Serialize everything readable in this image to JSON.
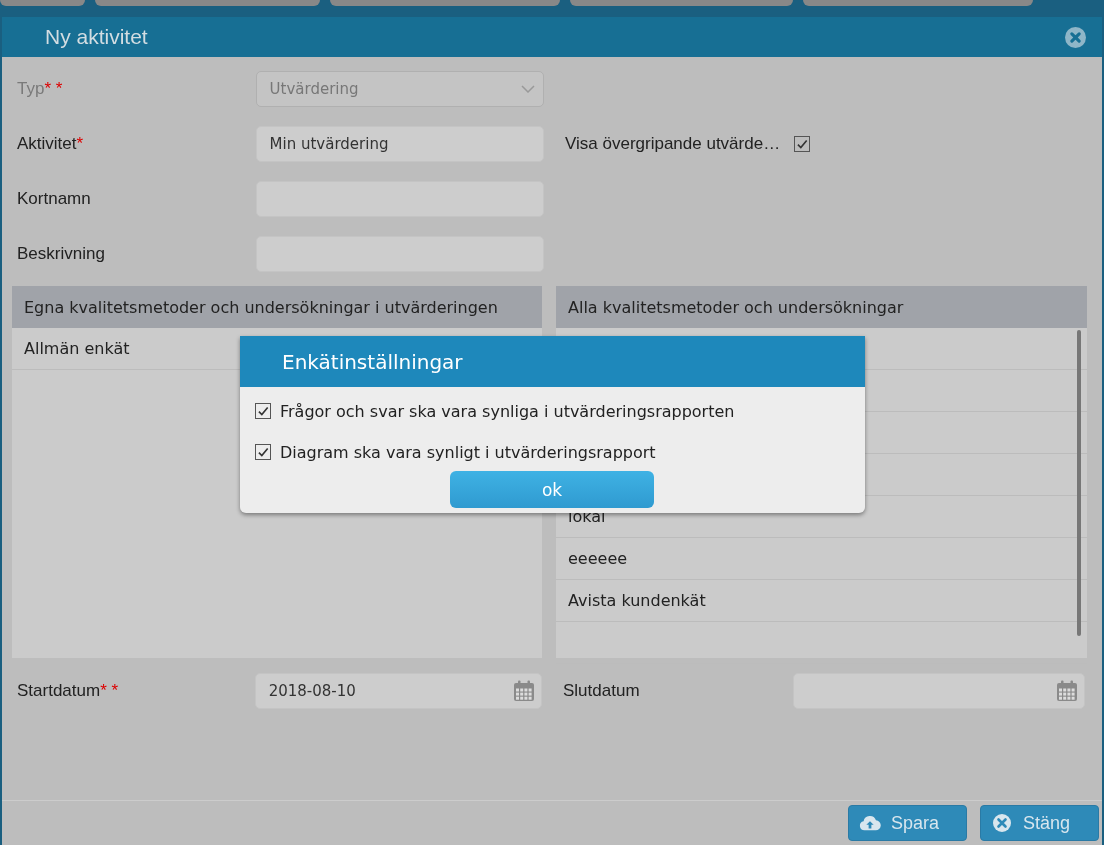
{
  "window": {
    "title": "Ny aktivitet"
  },
  "form": {
    "fields": [
      {
        "kind": "select",
        "label": "Typ",
        "required_marks": "* *",
        "disabled": true,
        "value": "Utvärdering"
      },
      {
        "kind": "text",
        "label": "Aktivitet",
        "required_marks": "*",
        "disabled": false,
        "value": "Min utvärdering"
      },
      {
        "kind": "text",
        "label": "Kortnamn",
        "disabled": false
      },
      {
        "kind": "text",
        "label": "Beskrivning",
        "disabled": false
      }
    ],
    "overall_option": {
      "label": "Visa övergripande utvärde…",
      "checked": true
    }
  },
  "own_list": {
    "header": "Egna kvalitetsmetoder och undersökningar i utvärderingen",
    "items": [
      "Allmän enkät"
    ]
  },
  "all_list": {
    "header": "Alla kvalitetsmetoder och undersökningar",
    "items": [
      "lokal",
      "eeeeee",
      "Avista kundenkät"
    ]
  },
  "dates": [
    {
      "label": "Startdatum",
      "required_marks": "* *",
      "value": "2018-08-10"
    },
    {
      "label": "Slutdatum"
    }
  ],
  "buttons": [
    {
      "kind": "upload",
      "label": "Spara"
    },
    {
      "kind": "close",
      "label": "Stäng"
    }
  ],
  "popup": {
    "title": "Enkätinställningar",
    "options": [
      {
        "label": "Frågor och svar ska vara synliga i utvärderingsrapporten",
        "checked": true
      },
      {
        "label": "Diagram ska vara synligt i utvärderingsrapport",
        "checked": true
      }
    ],
    "ok": "ok"
  }
}
